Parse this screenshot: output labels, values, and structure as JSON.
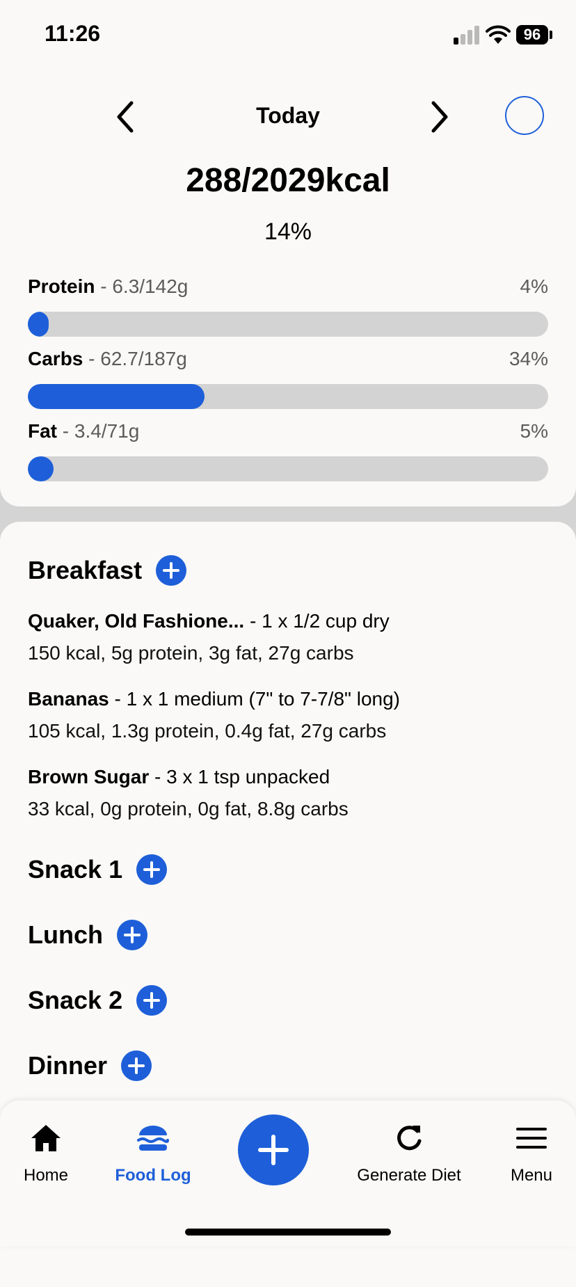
{
  "status_bar": {
    "time": "11:26",
    "battery": "96"
  },
  "header": {
    "date_label": "Today"
  },
  "summary": {
    "kcal": "288/2029kcal",
    "percent": "14%"
  },
  "macros": [
    {
      "name": "Protein",
      "amount": " - 6.3/142g",
      "percent": "4%",
      "fraction": 0.04
    },
    {
      "name": "Carbs",
      "amount": " - 62.7/187g",
      "percent": "34%",
      "fraction": 0.34
    },
    {
      "name": "Fat",
      "amount": " - 3.4/71g",
      "percent": "5%",
      "fraction": 0.05
    }
  ],
  "meals": {
    "breakfast": {
      "title": "Breakfast",
      "foods": [
        {
          "name": "Quaker, Old Fashione...",
          "serving": " - 1 x 1/2 cup dry",
          "detail": "150 kcal, 5g protein, 3g fat, 27g carbs"
        },
        {
          "name": "Bananas",
          "serving": " - 1 x 1 medium (7\" to 7-7/8\" long)",
          "detail": "105 kcal, 1.3g protein, 0.4g fat, 27g carbs"
        },
        {
          "name": "Brown Sugar",
          "serving": " - 3 x 1 tsp unpacked",
          "detail": "33 kcal, 0g protein, 0g fat, 8.8g carbs"
        }
      ]
    },
    "snack1": {
      "title": "Snack 1"
    },
    "lunch": {
      "title": "Lunch"
    },
    "snack2": {
      "title": "Snack 2"
    },
    "dinner": {
      "title": "Dinner"
    }
  },
  "tabs": {
    "home": "Home",
    "food_log": "Food Log",
    "generate_diet": "Generate Diet",
    "menu": "Menu"
  },
  "colors": {
    "accent": "#1e5fd9",
    "track": "#d3d3d3",
    "background": "#faf9f7"
  }
}
